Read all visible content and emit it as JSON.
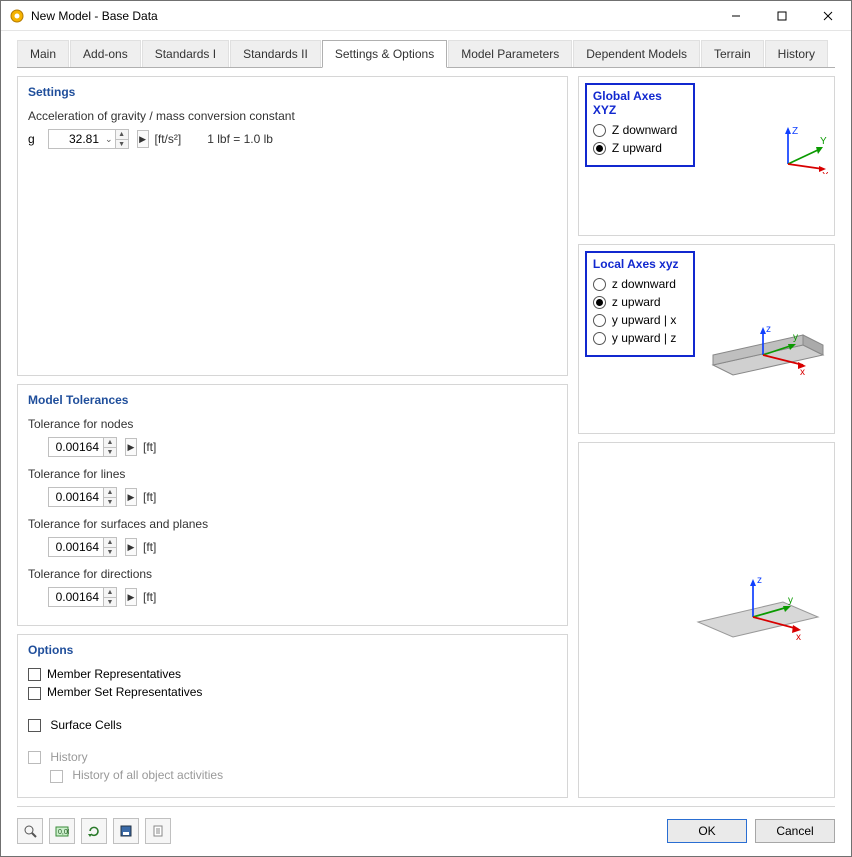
{
  "title": "New Model - Base Data",
  "tabs": [
    "Main",
    "Add-ons",
    "Standards I",
    "Standards II",
    "Settings & Options",
    "Model Parameters",
    "Dependent Models",
    "Terrain",
    "History"
  ],
  "active_tab": 4,
  "settings": {
    "title": "Settings",
    "accel_label": "Acceleration of gravity / mass conversion constant",
    "g_symbol": "g",
    "g_value": "32.81",
    "g_unit_html": "[ft/s²]",
    "g_note": "1 lbf = 1.0 lb"
  },
  "tolerances": {
    "title": "Model Tolerances",
    "rows": [
      {
        "label": "Tolerance for nodes",
        "value": "0.00164",
        "unit": "[ft]"
      },
      {
        "label": "Tolerance for lines",
        "value": "0.00164",
        "unit": "[ft]"
      },
      {
        "label": "Tolerance for surfaces and planes",
        "value": "0.00164",
        "unit": "[ft]"
      },
      {
        "label": "Tolerance for directions",
        "value": "0.00164",
        "unit": "[ft]"
      }
    ]
  },
  "options": {
    "title": "Options",
    "items": [
      {
        "label": "Member Representatives",
        "checked": false,
        "disabled": false
      },
      {
        "label": "Member Set Representatives",
        "checked": false,
        "disabled": false
      }
    ],
    "surface_cells": {
      "label": "Surface Cells",
      "checked": false,
      "disabled": false
    },
    "history": {
      "label": "History",
      "checked": false,
      "disabled": true
    },
    "history_sub": {
      "label": "History of all object activities",
      "checked": false,
      "disabled": true
    }
  },
  "global_axes": {
    "title": "Global Axes XYZ",
    "options": [
      {
        "label": "Z downward",
        "checked": false
      },
      {
        "label": "Z upward",
        "checked": true
      }
    ]
  },
  "local_axes": {
    "title": "Local Axes xyz",
    "options": [
      {
        "label": "z downward",
        "checked": false
      },
      {
        "label": "z upward",
        "checked": true
      },
      {
        "label": "y upward | x",
        "checked": false
      },
      {
        "label": "y upward | z",
        "checked": false
      }
    ]
  },
  "buttons": {
    "ok": "OK",
    "cancel": "Cancel"
  }
}
